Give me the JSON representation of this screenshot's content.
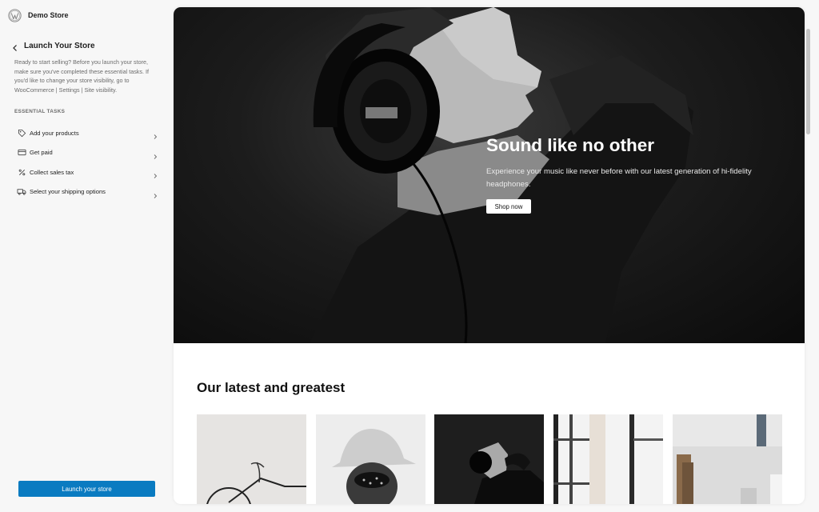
{
  "site": {
    "name": "Demo Store",
    "logo_icon": "wordpress-logo-icon"
  },
  "panel": {
    "title": "Launch Your Store",
    "back_icon": "chevron-left-icon",
    "description": "Ready to start selling? Before you launch your store, make sure you've completed these essential tasks. If you'd like to change your store visibility, go to WooCommerce | Settings | Site visibility.",
    "section_label": "ESSENTIAL TASKS",
    "tasks": [
      {
        "label": "Add your products",
        "icon": "tag-icon"
      },
      {
        "label": "Get paid",
        "icon": "credit-card-icon"
      },
      {
        "label": "Collect sales tax",
        "icon": "percent-icon"
      },
      {
        "label": "Select your shipping options",
        "icon": "truck-icon"
      }
    ],
    "launch_label": "Launch your store",
    "accent_color": "#0a7bc1"
  },
  "preview": {
    "hero": {
      "title": "Sound like no other",
      "text": "Experience your music like never before with our latest generation of hi-fidelity headphones.",
      "button_label": "Shop now"
    },
    "section_title": "Our latest and greatest",
    "products": [
      {
        "image": "bicycle-photo"
      },
      {
        "image": "woman-with-hat-photo"
      },
      {
        "image": "man-with-headphones-photo"
      },
      {
        "image": "window-curtain-photo"
      },
      {
        "image": "kitchen-jars-photo"
      }
    ]
  }
}
